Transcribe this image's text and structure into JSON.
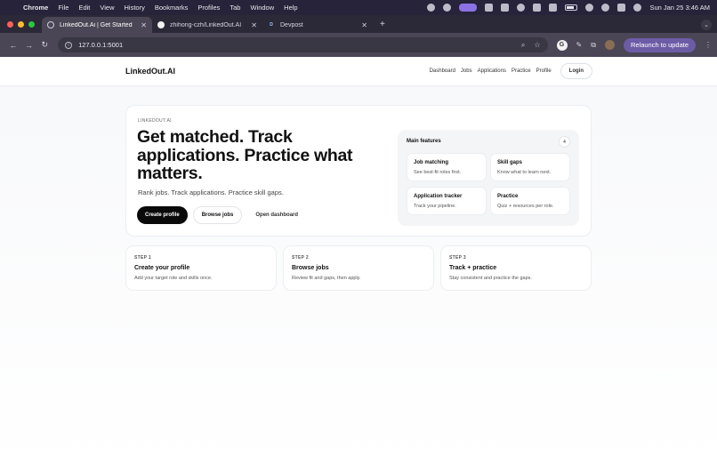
{
  "menubar": {
    "items": [
      "Chrome",
      "File",
      "Edit",
      "View",
      "History",
      "Bookmarks",
      "Profiles",
      "Tab",
      "Window",
      "Help"
    ],
    "clock": "Sun Jan 25  3:46 AM"
  },
  "tabs": [
    {
      "title": "LinkedOut.Ai | Get Started",
      "active": true,
      "favicon": "globe-icon"
    },
    {
      "title": "zhihong-czh/LinkedOut.AI",
      "active": false,
      "favicon": "github-icon"
    },
    {
      "title": "Devpost",
      "active": false,
      "favicon": "devpost-icon",
      "favicon_letter": "D"
    }
  ],
  "toolbar": {
    "url": "127.0.0.1:5001",
    "extension_letter": "G",
    "relaunch_label": "Relaunch to update"
  },
  "site": {
    "brand": "LinkedOut.AI",
    "nav": [
      "Dashboard",
      "Jobs",
      "Applications",
      "Practice",
      "Profile"
    ],
    "login_label": "Login"
  },
  "hero": {
    "eyebrow": "LINKEDOUT.AI",
    "headline": "Get matched. Track applications. Practice what matters.",
    "subline": "Rank jobs. Track applications. Practice skill gaps.",
    "cta_primary": "Create profile",
    "cta_secondary": "Browse jobs",
    "cta_tertiary": "Open dashboard"
  },
  "features": {
    "heading": "Main features",
    "count": "4",
    "items": [
      {
        "title": "Job matching",
        "desc": "See best-fit roles first."
      },
      {
        "title": "Skill gaps",
        "desc": "Know what to learn next."
      },
      {
        "title": "Application tracker",
        "desc": "Track your pipeline."
      },
      {
        "title": "Practice",
        "desc": "Quiz + resources per role."
      }
    ]
  },
  "steps": [
    {
      "num": "STEP 1",
      "title": "Create your profile",
      "desc": "Add your target role and skills once."
    },
    {
      "num": "STEP 2",
      "title": "Browse jobs",
      "desc": "Review fit and gaps, then apply."
    },
    {
      "num": "STEP 3",
      "title": "Track + practice",
      "desc": "Stay consistent and practice the gaps."
    }
  ],
  "colors": {
    "accent": "#8b72e4",
    "relaunch": "#6c5ca6",
    "primary_button": "#0a0a0a"
  }
}
